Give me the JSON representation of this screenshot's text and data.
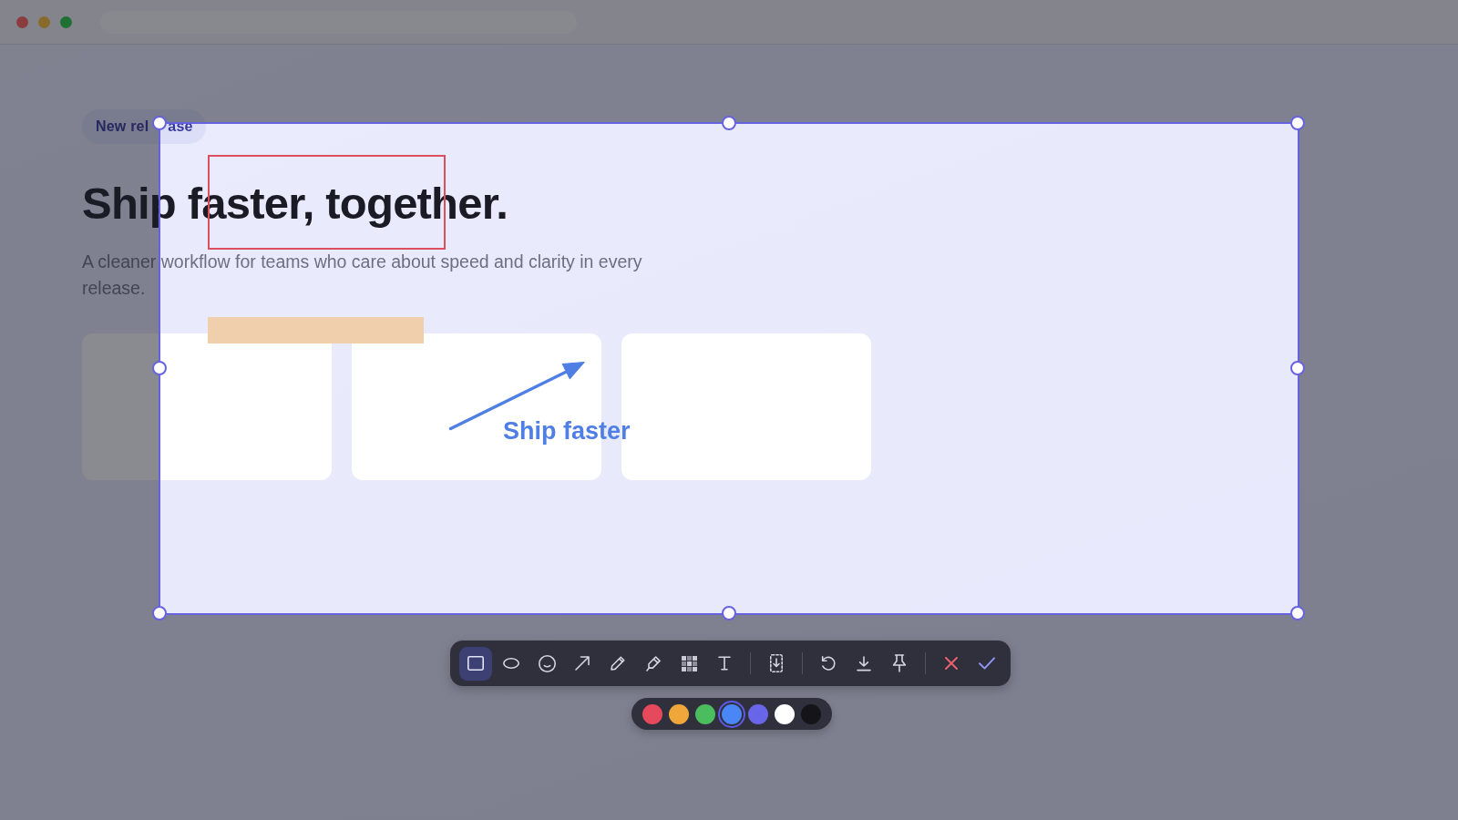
{
  "page": {
    "badge": {
      "texts": [
        "New rel",
        "ase"
      ]
    },
    "heading": "Ship faster, together.",
    "subtitle": "A cleaner workflow for teams who care about speed and clarity in every release."
  },
  "annotations": [
    {
      "kind": "rectangle",
      "color": "#dc4f5e"
    },
    {
      "kind": "highlight",
      "color": "#efcfac"
    },
    {
      "kind": "arrow",
      "color": "#4f7fe4"
    },
    {
      "kind": "text",
      "text": "Ship faster",
      "color": "#4f7fe4"
    }
  ],
  "toolbar": {
    "groups": [
      {
        "items": [
          {
            "kind": "rectangle",
            "selected": true
          },
          {
            "kind": "ellipse",
            "selected": false
          },
          {
            "kind": "emoji",
            "selected": false
          },
          {
            "kind": "arrow",
            "selected": false
          },
          {
            "kind": "pen",
            "selected": false
          },
          {
            "kind": "marker",
            "selected": false
          },
          {
            "kind": "mosaic",
            "selected": false
          },
          {
            "kind": "text",
            "selected": false
          }
        ]
      },
      {
        "items": [
          {
            "kind": "scroll_capture"
          }
        ]
      },
      {
        "items": [
          {
            "kind": "undo"
          },
          {
            "kind": "download"
          },
          {
            "kind": "pin"
          }
        ]
      },
      {
        "items": [
          {
            "kind": "cancel"
          },
          {
            "kind": "confirm"
          }
        ]
      }
    ]
  },
  "palette": {
    "colors": [
      {
        "color": "#e5495b",
        "selected": false
      },
      {
        "color": "#efa63b",
        "selected": false
      },
      {
        "color": "#4bbd5f",
        "selected": false
      },
      {
        "color": "#4b86f6",
        "selected": true
      },
      {
        "color": "#6966ea",
        "selected": false
      },
      {
        "color": "#ffffff",
        "selected": false
      },
      {
        "color": "#141419",
        "selected": false
      }
    ]
  }
}
